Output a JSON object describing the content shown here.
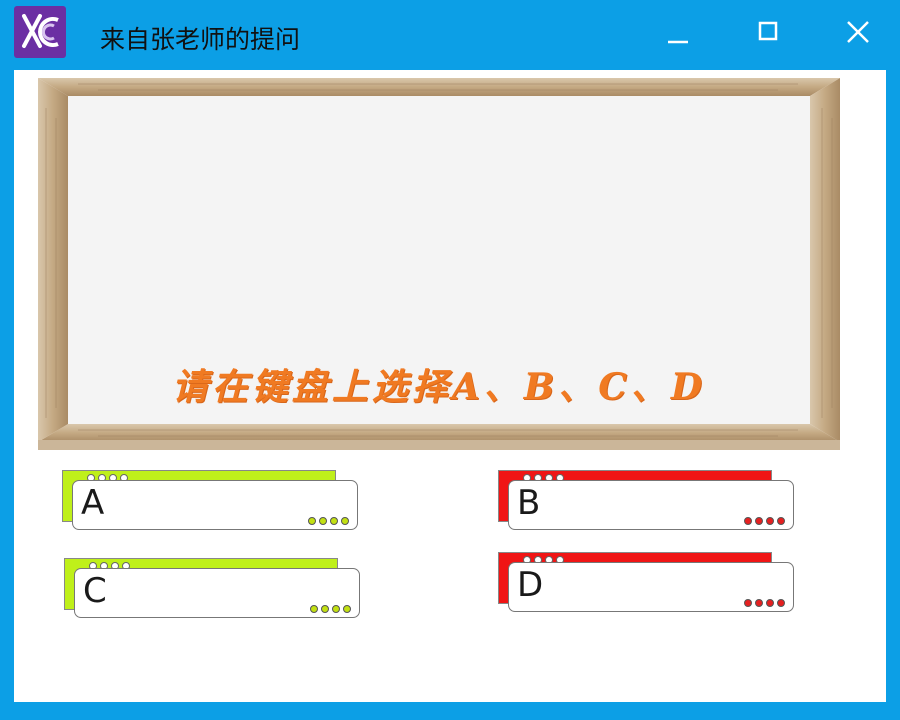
{
  "window": {
    "title": "来自张老师的提问",
    "logo_icon": "xc-logo-icon",
    "controls": [
      "minimize-icon",
      "maximize-icon",
      "close-icon"
    ]
  },
  "board": {
    "instruction": "请在键盘上选择A、B、C、D"
  },
  "options": [
    {
      "letter": "A",
      "color": "#bff01a"
    },
    {
      "letter": "B",
      "color": "#f01515"
    },
    {
      "letter": "C",
      "color": "#bff01a"
    },
    {
      "letter": "D",
      "color": "#f01515"
    }
  ],
  "colors": {
    "titlebar": "#0c9fe6",
    "instruction_text": "#f07a22",
    "logo_bg": "#6b2fa3"
  }
}
